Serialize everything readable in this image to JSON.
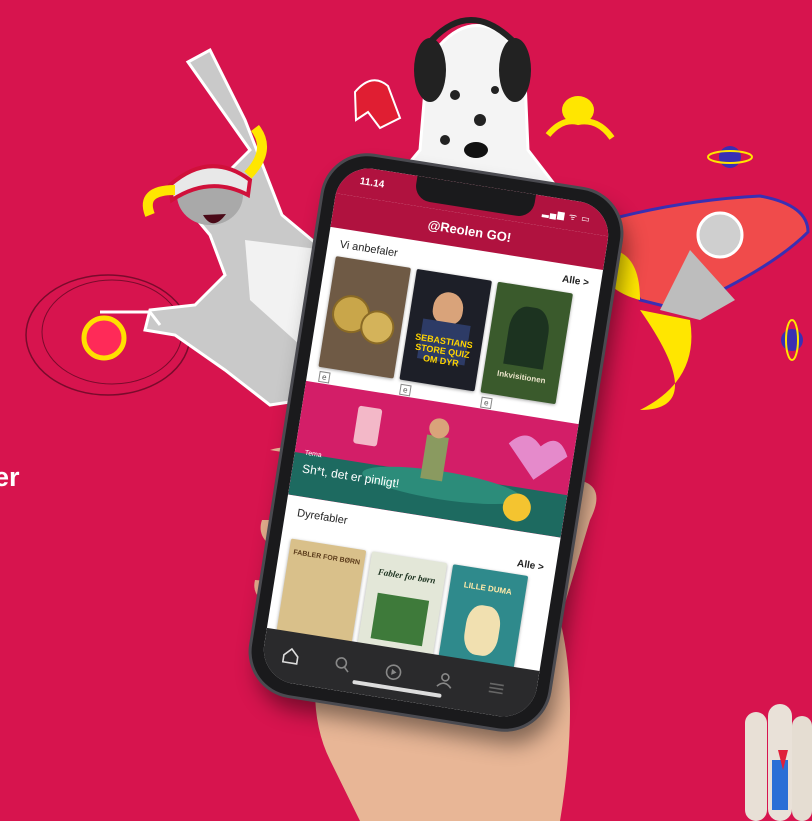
{
  "background": {
    "color": "#d7144e",
    "side_text": "er"
  },
  "phone": {
    "status": {
      "time": "11.14",
      "icons": "▂▄▆ ᯤ ▭"
    },
    "app_title": "@Reolen GO!",
    "sections": [
      {
        "title": "Vi anbefaler",
        "all_label": "Alle >",
        "books": [
          {
            "title": "",
            "color": "#6f5a45",
            "badge": "e"
          },
          {
            "title": "SEBASTIANS STORE QUIZ OM DYR",
            "color": "#1d1f28",
            "badge": "e"
          },
          {
            "title": "Inkvisitionen",
            "color": "#3a5a2c",
            "badge": "e"
          }
        ]
      },
      {
        "title": "Dyrefabler",
        "all_label": "Alle >",
        "books": [
          {
            "title": "FABLER FOR BØRN",
            "color": "#d9c08a",
            "badge": ""
          },
          {
            "title": "Fabler for børn",
            "color": "#e3e7d8",
            "badge": ""
          },
          {
            "title": "LILLE DUMA",
            "color": "#2f8a8c",
            "badge": ""
          }
        ]
      }
    ],
    "banner": {
      "tag": "Tema",
      "title": "Sh*t, det er pinligt!",
      "color": "#d31e68"
    },
    "tabs": [
      "home-icon",
      "search-icon",
      "play-icon",
      "profile-icon",
      "menu-icon"
    ]
  }
}
